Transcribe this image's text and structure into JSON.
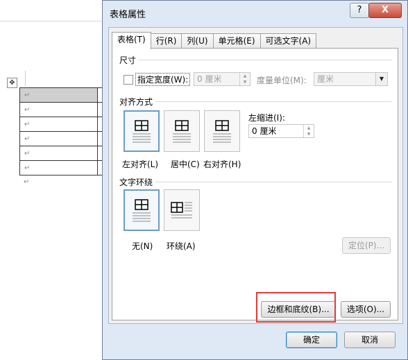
{
  "dialog": {
    "title": "表格属性",
    "help_label": "?",
    "close_label": "X"
  },
  "tabs": [
    {
      "label": "表格(T)",
      "selected": true
    },
    {
      "label": "行(R)",
      "selected": false
    },
    {
      "label": "列(U)",
      "selected": false
    },
    {
      "label": "单元格(E)",
      "selected": false
    },
    {
      "label": "可选文字(A)",
      "selected": false
    }
  ],
  "size": {
    "group_label": "尺寸",
    "preferred_width_label": "指定宽度(W):",
    "preferred_width_checked": false,
    "width_value": "0 厘米",
    "unit_label": "度量单位(M):",
    "unit_value": "厘米"
  },
  "alignment": {
    "group_label": "对齐方式",
    "options": [
      {
        "label": "左对齐(L)",
        "selected": true
      },
      {
        "label": "居中(C)",
        "selected": false
      },
      {
        "label": "右对齐(H)",
        "selected": false
      }
    ],
    "indent_label": "左缩进(I):",
    "indent_value": "0 厘米"
  },
  "wrapping": {
    "group_label": "文字环绕",
    "options": [
      {
        "label": "无(N)",
        "selected": true
      },
      {
        "label": "环绕(A)",
        "selected": false
      }
    ],
    "position_button": "定位(P)..."
  },
  "buttons": {
    "borders": "边框和底纹(B)...",
    "options": "选项(O)...",
    "ok": "确定",
    "cancel": "取消"
  },
  "document": {
    "paragraph_mark": "↵",
    "move_handle": "✥"
  }
}
